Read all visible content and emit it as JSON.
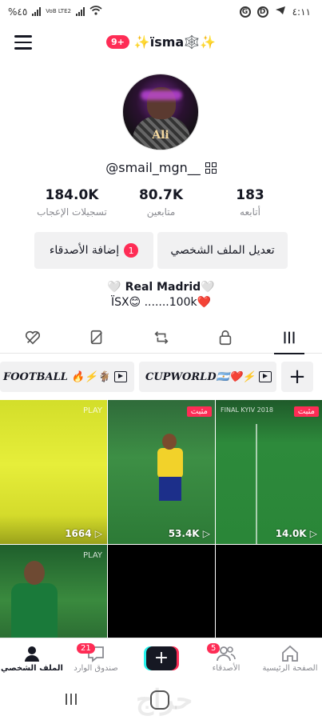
{
  "status_bar": {
    "battery": "%٤٥",
    "network": "VoB LTE2",
    "time": "٤:١١",
    "notif_icons": [
      "g-icon",
      "d-icon",
      "telegram-icon"
    ]
  },
  "header": {
    "notification_count": "9+",
    "username_title": "✨ïsma🕸️✨"
  },
  "profile": {
    "avatar_label": "Ali",
    "handle": "@smail_mgn__",
    "stats": [
      {
        "number": "183",
        "label": "أتابعه"
      },
      {
        "number": "80.7K",
        "label": "متابعين"
      },
      {
        "number": "184.0K",
        "label": "تسجيلات الإعجاب"
      }
    ],
    "edit_button": "تعديل الملف الشخصي",
    "add_friends_button": "إضافة الأصدقاء",
    "add_friends_badge": "1",
    "bio_line1": "🤍 Real Madrid🤍",
    "bio_line2": "ÏSX😊 .......100k❤️"
  },
  "tabs": [
    "videos-grid-icon",
    "private-lock-icon",
    "repost-icon",
    "favorites-icon",
    "liked-icon"
  ],
  "playlists": [
    {
      "label": "FOOTBALL 🔥⚡🐐"
    },
    {
      "label": "CUPWORLD🇦🇷❤️⚡"
    }
  ],
  "playlist_add": "+",
  "videos": [
    {
      "views": "1664",
      "pinned": "",
      "watermark": "PLAY"
    },
    {
      "views": "53.4K",
      "pinned": "مثبت",
      "watermark": ""
    },
    {
      "views": "14.0K",
      "pinned": "مثبت",
      "watermark": "FINAL KYIV 2018"
    },
    {
      "views": "",
      "pinned": "",
      "watermark": "PLAY"
    },
    {
      "views": "",
      "pinned": "",
      "watermark": ""
    },
    {
      "views": "",
      "pinned": "",
      "watermark": ""
    }
  ],
  "bottom_nav": {
    "profile": "الملف الشخصي",
    "inbox": "صندوق الوارد",
    "inbox_badge": "21",
    "create": "+",
    "friends": "الأصدقاء",
    "friends_badge": "5",
    "home": "الصفحة الرئيسية"
  },
  "colors": {
    "accent": "#fe2c55",
    "cyan": "#25f4ee",
    "text": "#161823",
    "muted": "#8a8b91"
  }
}
